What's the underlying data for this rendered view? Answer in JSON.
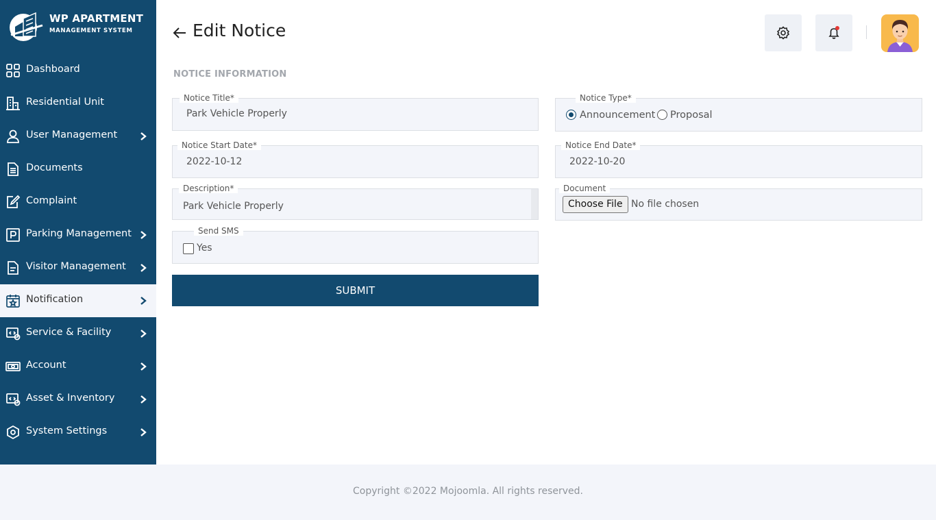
{
  "app": {
    "logo_line1": "WP APARTMENT",
    "logo_line2": "MANAGEMENT SYSTEM"
  },
  "sidebar": {
    "items": [
      {
        "label": "Dashboard",
        "icon": "grid-icon",
        "has_arrow": false
      },
      {
        "label": "Residential Unit",
        "icon": "building-icon",
        "has_arrow": false
      },
      {
        "label": "User Management",
        "icon": "user-icon",
        "has_arrow": true
      },
      {
        "label": "Documents",
        "icon": "document-icon",
        "has_arrow": false
      },
      {
        "label": "Complaint",
        "icon": "edit-icon",
        "has_arrow": false
      },
      {
        "label": "Parking Management",
        "icon": "parking-icon",
        "has_arrow": true
      },
      {
        "label": "Visitor Management",
        "icon": "clipboard-icon",
        "has_arrow": true
      },
      {
        "label": "Notification",
        "icon": "calendar-star-icon",
        "has_arrow": true,
        "active": true
      },
      {
        "label": "Service & Facility",
        "icon": "service-icon",
        "has_arrow": true
      },
      {
        "label": "Account",
        "icon": "money-icon",
        "has_arrow": true
      },
      {
        "label": "Asset & Inventory",
        "icon": "inventory-icon",
        "has_arrow": true
      },
      {
        "label": "System Settings",
        "icon": "settings-icon",
        "has_arrow": true
      }
    ]
  },
  "header": {
    "title": "Edit Notice"
  },
  "form": {
    "section_title": "NOTICE INFORMATION",
    "notice_title": {
      "label": "Notice Title*",
      "value": "Park Vehicle Properly"
    },
    "notice_type": {
      "label": "Notice Type*",
      "options": [
        "Announcement",
        "Proposal"
      ],
      "selected": "Announcement"
    },
    "start_date": {
      "label": "Notice Start Date*",
      "value": "2022-10-12"
    },
    "end_date": {
      "label": "Notice End Date*",
      "value": "2022-10-20"
    },
    "description": {
      "label": "Description*",
      "value": "Park Vehicle Properly"
    },
    "document": {
      "label": "Document",
      "button": "Choose File",
      "status": "No file chosen"
    },
    "send_sms": {
      "label": "Send SMS",
      "option": "Yes",
      "checked": false
    },
    "submit_label": "SUBMIT"
  },
  "footer": {
    "copyright": "Copyright ©2022 Mojoomla. All rights reserved."
  },
  "colors": {
    "sidebar_bg": "#124a6f",
    "field_bg": "#f3f5fa",
    "avatar_bg": "#f8b94c",
    "notification_dot": "#e53935"
  }
}
